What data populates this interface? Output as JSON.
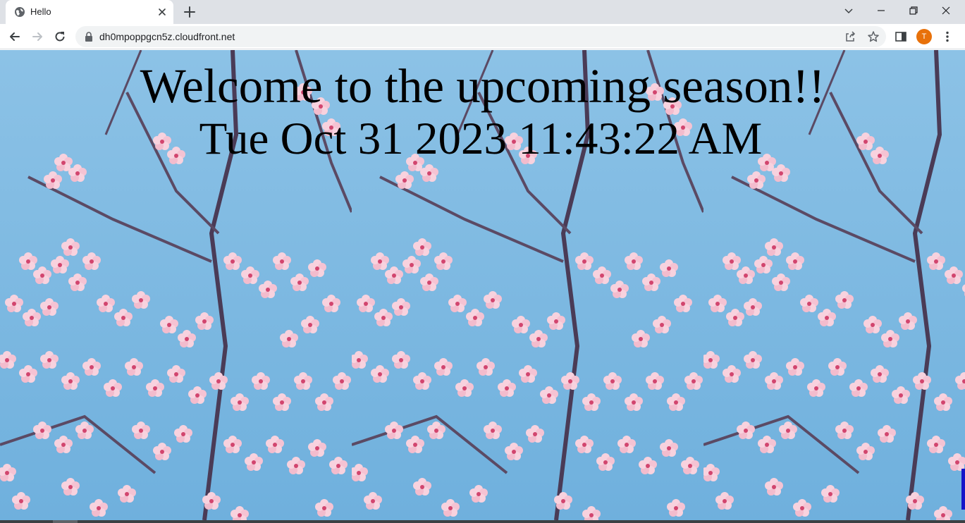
{
  "browser": {
    "tab_title": "Hello",
    "url": "dh0mpoppgcn5z.cloudfront.net",
    "profile_initial": "T",
    "profile_color": "#e8710a"
  },
  "page": {
    "heading": "Welcome to the upcoming season!!",
    "datetime": "Tue Oct 31 2023 11:43:22 AM",
    "background": "cherry-blossom-image",
    "sky_color": "#7db8e0",
    "blossom_color": "#f4c6d6"
  },
  "icons": {
    "favicon": "globe-icon",
    "tab_close": "close-icon",
    "new_tab": "plus-icon",
    "back": "arrow-left-icon",
    "forward": "arrow-right-icon",
    "reload": "reload-icon",
    "lock": "lock-icon",
    "share": "share-icon",
    "bookmark": "star-icon",
    "side_panel": "side-panel-icon",
    "menu": "kebab-menu-icon"
  }
}
